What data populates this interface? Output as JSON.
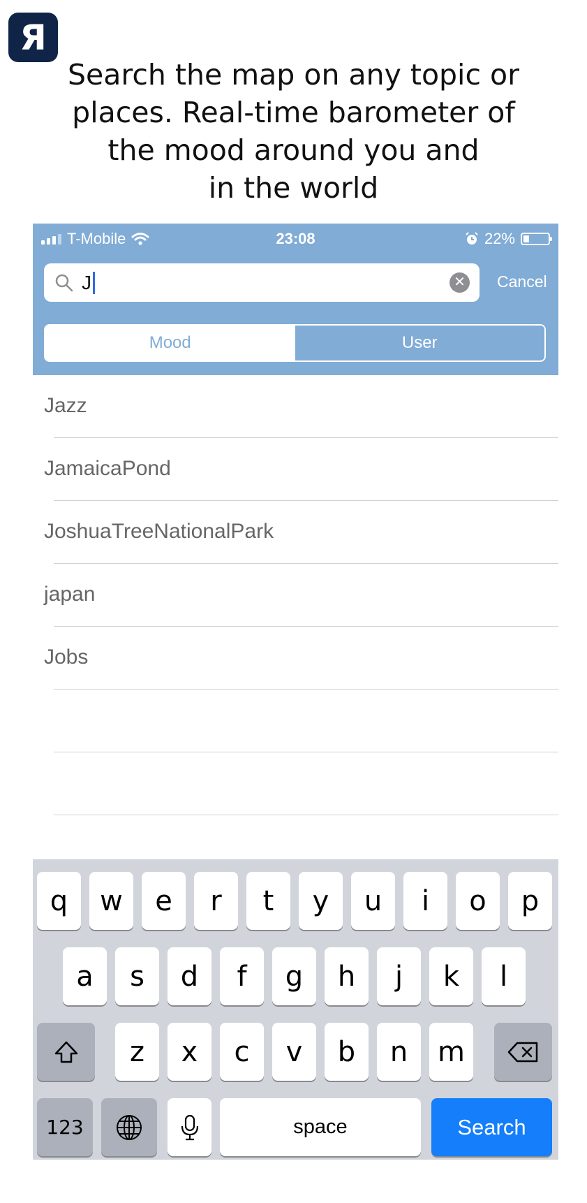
{
  "logo": {
    "glyph": "Я"
  },
  "headline": {
    "line1": "Search the map on any topic or",
    "line2": "places. Real-time barometer of",
    "line3": "the mood around you and",
    "line4": "in the world"
  },
  "status_bar": {
    "carrier": "T-Mobile",
    "time": "23:08",
    "battery_percent": "22%"
  },
  "search": {
    "query": "J",
    "cancel_label": "Cancel"
  },
  "segments": [
    {
      "label": "Mood",
      "selected": false
    },
    {
      "label": "User",
      "selected": true
    }
  ],
  "results": [
    "Jazz",
    "JamaicaPond",
    "JoshuaTreeNationalPark",
    "japan",
    "Jobs",
    "",
    ""
  ],
  "keyboard": {
    "row1": [
      "q",
      "w",
      "e",
      "r",
      "t",
      "y",
      "u",
      "i",
      "o",
      "p"
    ],
    "row2": [
      "a",
      "s",
      "d",
      "f",
      "g",
      "h",
      "j",
      "k",
      "l"
    ],
    "row3": [
      "z",
      "x",
      "c",
      "v",
      "b",
      "n",
      "m"
    ],
    "numbers_label": "123",
    "space_label": "space",
    "search_label": "Search"
  },
  "colors": {
    "accent": "#80acd6",
    "search_key": "#147efb",
    "logo_bg": "#0f2447"
  }
}
